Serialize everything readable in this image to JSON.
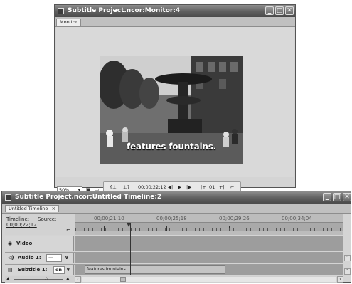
{
  "monitor": {
    "title": "Subtitle Project.ncor:Monitor:4",
    "tab": "Monitor",
    "caption": "features fountains.",
    "timecode": "00;00;22;12",
    "zoom": "50%",
    "transport": {
      "mark_in": "{⊥",
      "mark_out": "⊥}",
      "step_back": "◀|",
      "play": "▶",
      "step_forward": "|▶",
      "go_in": "|+",
      "counter": "01",
      "go_out": "+|"
    }
  },
  "timeline": {
    "title": "Subtitle Project.ncor:Untitled Timeline:2",
    "tab": "Untitled Timeline",
    "tab_close": "×",
    "timeline_label": "Timeline:",
    "source_label": "Source:",
    "timeline_timecode": "00;00;22;12",
    "ruler_labels": [
      "00;00;21;10",
      "00;00;25;18",
      "00;00;29;26",
      "00;00;34;04"
    ],
    "tracks": [
      {
        "name": "Video",
        "icon": "eye-icon"
      },
      {
        "name": "Audio 1:",
        "icon": "speaker-icon",
        "value": "—"
      },
      {
        "name": "Subtitle 1:",
        "icon": "subtitle-icon",
        "value": "en",
        "clip": "features fountains."
      }
    ]
  },
  "colors": {
    "titlebar": "#5f5f5f",
    "window_bg": "#d4d4d4",
    "track_bg": "#9d9d9d",
    "playhead": "#333333"
  }
}
